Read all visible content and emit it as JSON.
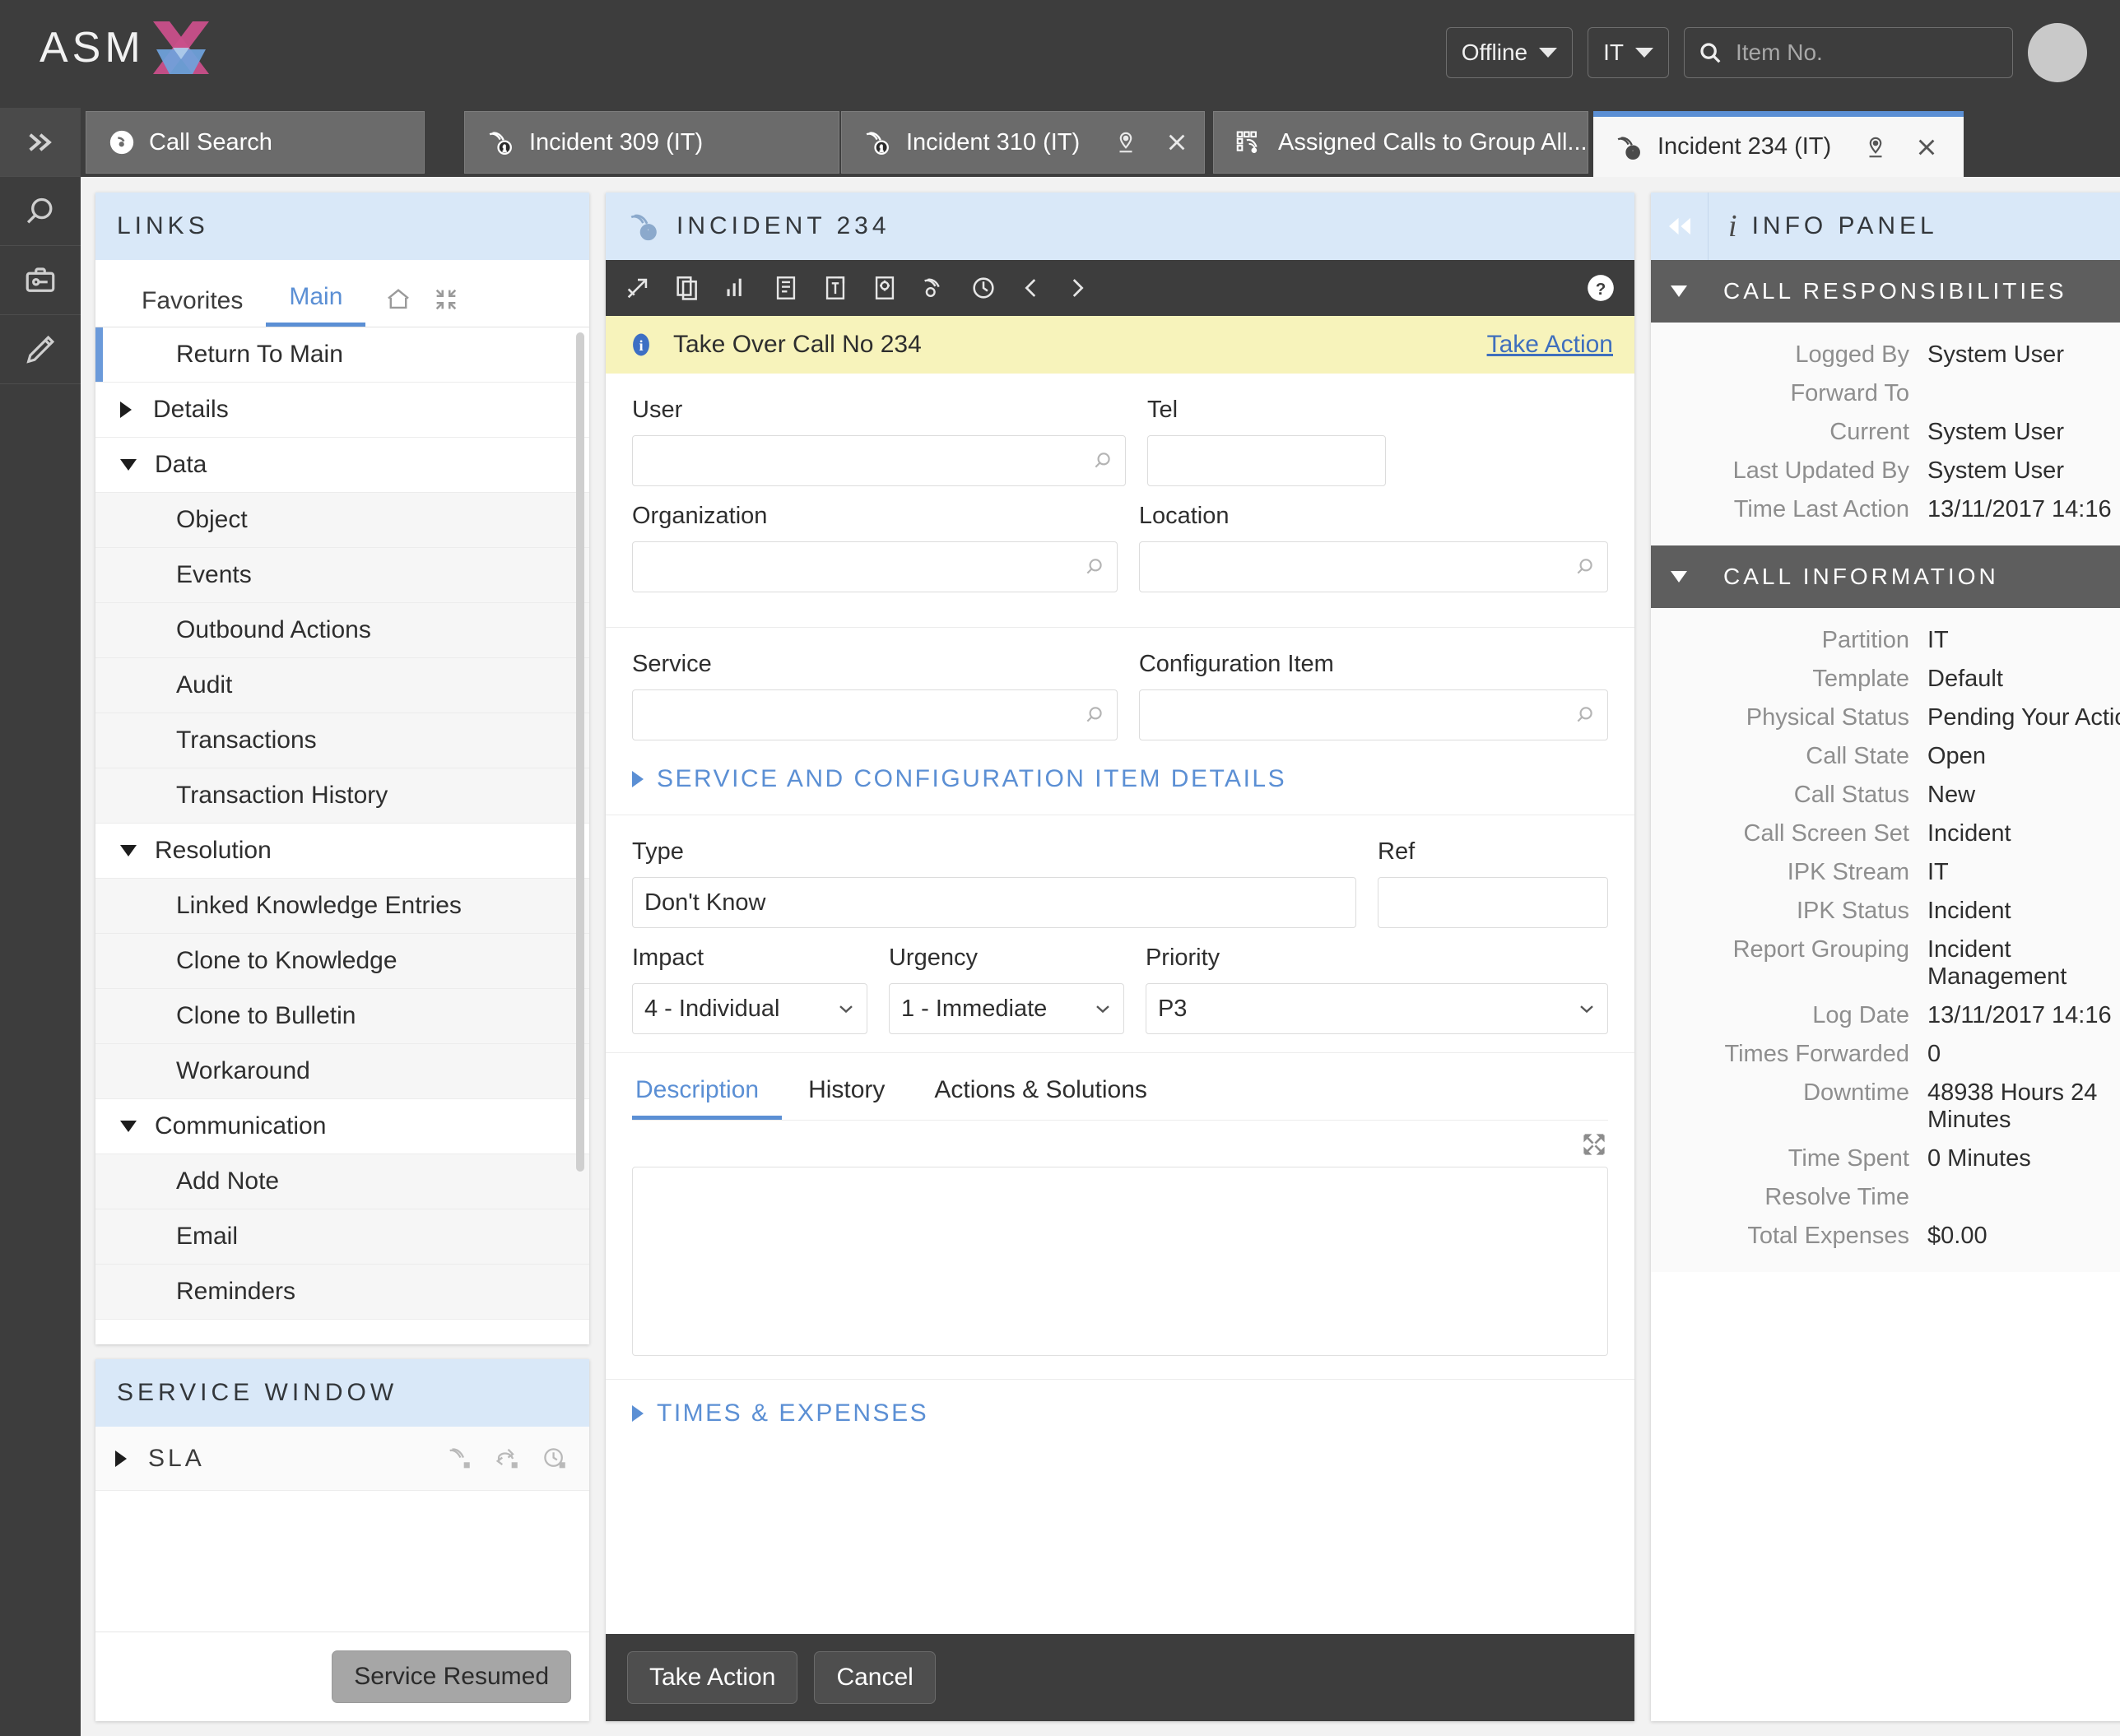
{
  "app": {
    "logo_text": "ASM",
    "brand_pink": "#c94f8a",
    "brand_blue": "#6fa3dd",
    "accent_blue": "#5b8fd4"
  },
  "topbar": {
    "status_label": "Offline",
    "partition_label": "IT",
    "search_placeholder": "Item No.",
    "search_value": ""
  },
  "tabs": [
    {
      "label": "Call Search",
      "icon": "call-icon",
      "active": false,
      "pin": false,
      "close": false
    },
    {
      "label": "Incident 309 (IT)",
      "icon": "incident-icon",
      "active": false,
      "pin": false,
      "close": false
    },
    {
      "label": "Incident 310 (IT)",
      "icon": "incident-icon",
      "active": false,
      "pin": true,
      "close": true
    },
    {
      "label": "Assigned Calls to Group All...",
      "icon": "assigned-calls-icon",
      "active": false,
      "pin": false,
      "close": false
    },
    {
      "label": "Incident 234 (IT)",
      "icon": "incident-icon",
      "active": true,
      "pin": true,
      "close": true
    }
  ],
  "rail": {
    "items": [
      {
        "icon": "chevrons-right-icon"
      },
      {
        "icon": "search-icon"
      },
      {
        "icon": "toolbox-icon"
      },
      {
        "icon": "pencil-icon"
      }
    ]
  },
  "links": {
    "header": "LINKS",
    "tabs": [
      {
        "label": "Favorites",
        "active": false
      },
      {
        "label": "Main",
        "active": true
      }
    ],
    "icons": [
      "home-icon",
      "collapse-icon"
    ],
    "items": [
      {
        "label": "Return To Main",
        "level": "selected",
        "toggle": "none"
      },
      {
        "label": "Details",
        "level": "group",
        "toggle": "closed"
      },
      {
        "label": "Data",
        "level": "group",
        "toggle": "open"
      },
      {
        "label": "Object",
        "level": "child",
        "toggle": "none"
      },
      {
        "label": "Events",
        "level": "child",
        "toggle": "none"
      },
      {
        "label": "Outbound Actions",
        "level": "child",
        "toggle": "none"
      },
      {
        "label": "Audit",
        "level": "child",
        "toggle": "none"
      },
      {
        "label": "Transactions",
        "level": "child",
        "toggle": "none"
      },
      {
        "label": "Transaction History",
        "level": "child",
        "toggle": "none"
      },
      {
        "label": "Resolution",
        "level": "group",
        "toggle": "open"
      },
      {
        "label": "Linked Knowledge Entries",
        "level": "child",
        "toggle": "none"
      },
      {
        "label": "Clone to Knowledge",
        "level": "child",
        "toggle": "none"
      },
      {
        "label": "Clone to Bulletin",
        "level": "child",
        "toggle": "none"
      },
      {
        "label": "Workaround",
        "level": "child",
        "toggle": "none"
      },
      {
        "label": "Communication",
        "level": "group",
        "toggle": "open"
      },
      {
        "label": "Add Note",
        "level": "child",
        "toggle": "none"
      },
      {
        "label": "Email",
        "level": "child",
        "toggle": "none"
      },
      {
        "label": "Reminders",
        "level": "child",
        "toggle": "none"
      }
    ]
  },
  "service_window": {
    "header": "SERVICE WINDOW",
    "sla_label": "SLA",
    "sla_icons": [
      "call-hold-icon",
      "forward-hold-icon",
      "clock-hold-icon"
    ],
    "resume_button": "Service Resumed"
  },
  "incident": {
    "header": "INCIDENT 234",
    "toolbar_icons": [
      "detach-icon",
      "copy-icon",
      "chart-icon",
      "document-icon",
      "document-export-icon",
      "settings-doc-icon",
      "call-icon",
      "clock-icon",
      "prev-icon",
      "next-icon"
    ],
    "help_icon": "help-icon",
    "notice": {
      "icon": "info-icon",
      "text": "Take Over Call No 234",
      "action": "Take Action"
    },
    "fields": {
      "user": {
        "label": "User",
        "value": "",
        "search": true
      },
      "tel": {
        "label": "Tel",
        "value": "",
        "search": false
      },
      "organization": {
        "label": "Organization",
        "value": "",
        "search": true
      },
      "location": {
        "label": "Location",
        "value": "",
        "search": true
      },
      "service": {
        "label": "Service",
        "value": "",
        "search": true
      },
      "configuration_item": {
        "label": "Configuration Item",
        "value": "",
        "search": true
      },
      "type": {
        "label": "Type",
        "value": "Don't Know"
      },
      "ref": {
        "label": "Ref",
        "value": ""
      },
      "impact": {
        "label": "Impact",
        "value": "4 - Individual"
      },
      "urgency": {
        "label": "Urgency",
        "value": "1 - Immediate"
      },
      "priority": {
        "label": "Priority",
        "value": "P3"
      }
    },
    "service_ci_details_link": "SERVICE AND CONFIGURATION ITEM DETAILS",
    "times_expenses_link": "TIMES & EXPENSES",
    "content_tabs": [
      {
        "label": "Description",
        "active": true
      },
      {
        "label": "History",
        "active": false
      },
      {
        "label": "Actions & Solutions",
        "active": false
      }
    ],
    "description_value": "",
    "expand_icon": "expand-icon",
    "footer": {
      "primary": "Take Action",
      "secondary": "Cancel"
    }
  },
  "info_panel": {
    "header": "INFO PANEL",
    "collapse_icon": "collapse-left-icon",
    "sections": [
      {
        "title": "CALL RESPONSIBILITIES",
        "rows": [
          {
            "key": "Logged By",
            "value": "System User"
          },
          {
            "key": "Forward To",
            "value": ""
          },
          {
            "key": "Current",
            "value": "System User"
          },
          {
            "key": "Last Updated By",
            "value": "System User"
          },
          {
            "key": "Time Last Action",
            "value": "13/11/2017 14:16"
          }
        ]
      },
      {
        "title": "CALL INFORMATION",
        "rows": [
          {
            "key": "Partition",
            "value": "IT"
          },
          {
            "key": "Template",
            "value": "Default"
          },
          {
            "key": "Physical Status",
            "value": "Pending Your Action"
          },
          {
            "key": "Call State",
            "value": "Open"
          },
          {
            "key": "Call Status",
            "value": "New"
          },
          {
            "key": "Call Screen Set",
            "value": "Incident"
          },
          {
            "key": "IPK Stream",
            "value": "IT"
          },
          {
            "key": "IPK Status",
            "value": "Incident"
          },
          {
            "key": "Report Grouping",
            "value": "Incident Management"
          },
          {
            "key": "Log Date",
            "value": "13/11/2017 14:16"
          },
          {
            "key": "Times Forwarded",
            "value": "0"
          },
          {
            "key": "Downtime",
            "value": "48938 Hours 24 Minutes"
          },
          {
            "key": "Time Spent",
            "value": "0 Minutes"
          },
          {
            "key": "Resolve Time",
            "value": ""
          },
          {
            "key": "Total Expenses",
            "value": "$0.00"
          }
        ]
      }
    ]
  }
}
